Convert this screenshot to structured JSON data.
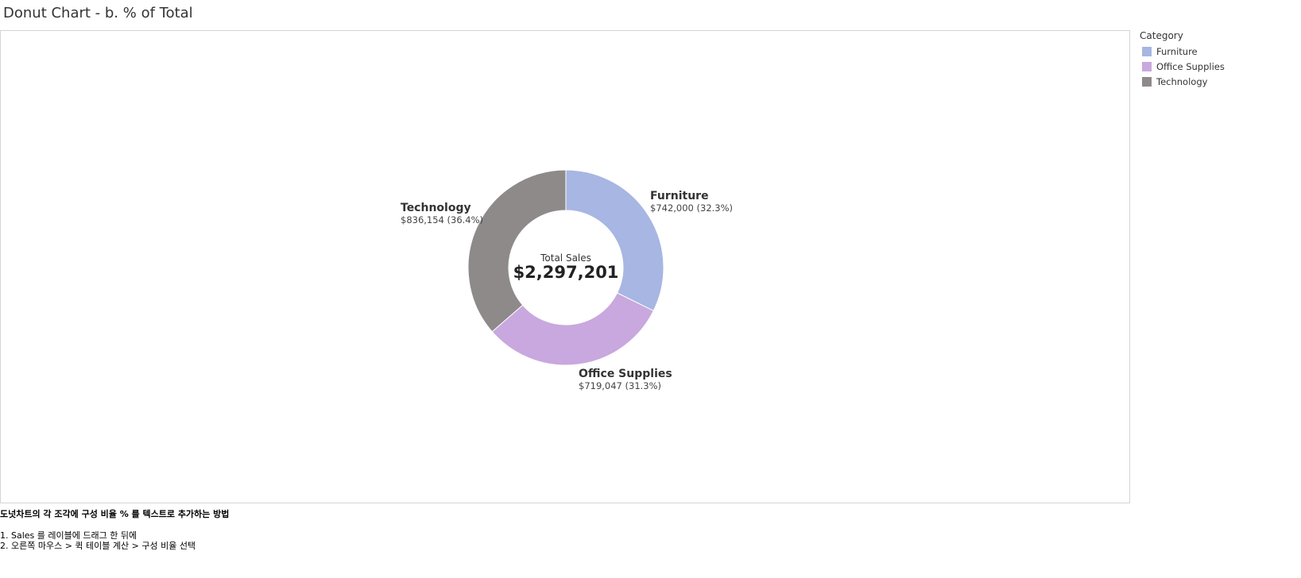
{
  "title": "Donut Chart - b. % of Total",
  "legend": {
    "title": "Category",
    "items": [
      {
        "label": "Furniture",
        "color": "#a7b6e2"
      },
      {
        "label": "Office Supplies",
        "color": "#c8a8de"
      },
      {
        "label": "Technology",
        "color": "#8e8a8a"
      }
    ]
  },
  "center": {
    "label": "Total Sales",
    "value": "$2,297,201"
  },
  "notes": {
    "heading": "도넛차트의 각 조각에 구성 비율 % 를 텍스트로 추가하는 방법",
    "steps": [
      "1. Sales 를 레이블에 드래그 한 뒤에",
      "2. 오른쪽 마우스 > 퀵 테이블 계산 > 구성 비율 선택"
    ]
  },
  "chart_data": {
    "type": "pie",
    "donut": true,
    "title": "Donut Chart - b. % of Total",
    "legend_position": "right",
    "legend_title": "Category",
    "categories": [
      "Furniture",
      "Office Supplies",
      "Technology"
    ],
    "values": [
      742000,
      719047,
      836154
    ],
    "percent": [
      32.3,
      31.3,
      36.4
    ],
    "colors": [
      "#a7b6e2",
      "#c8a8de",
      "#8e8a8a"
    ],
    "value_labels": [
      "$742,000 (32.3%)",
      "$719,047 (31.3%)",
      "$836,154 (36.4%)"
    ],
    "total_label": "Total Sales",
    "total_value": "$2,297,201"
  }
}
